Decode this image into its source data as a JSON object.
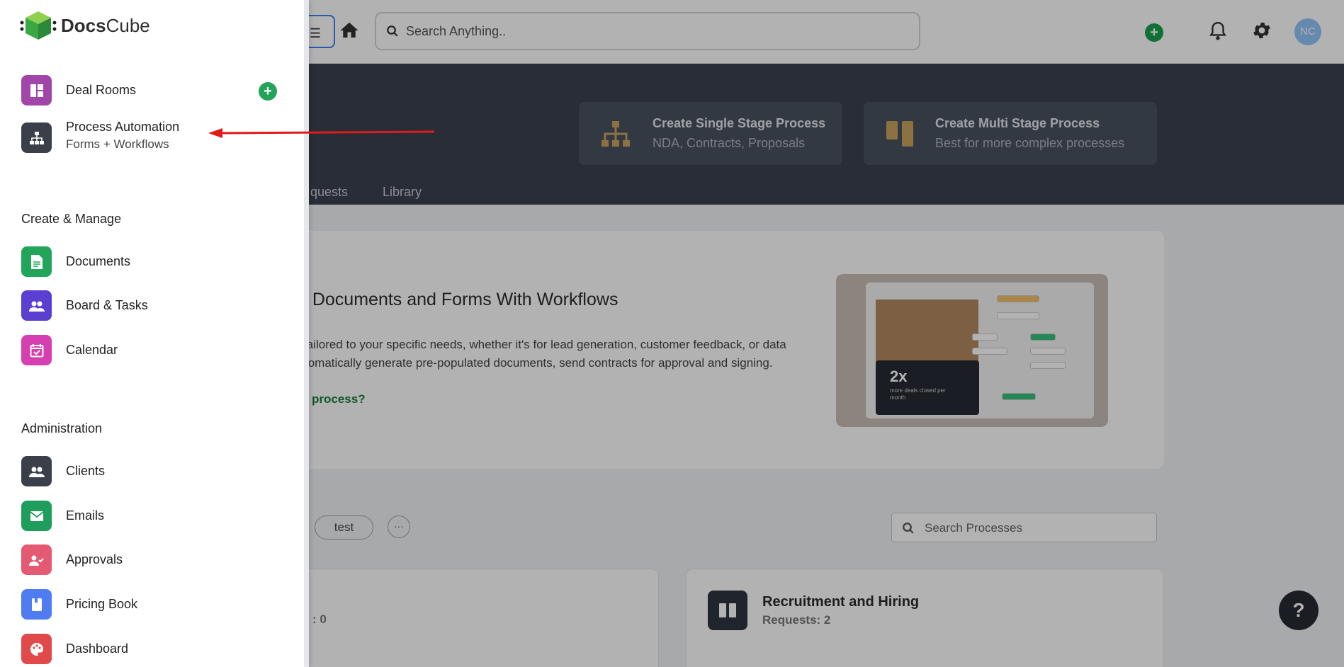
{
  "app": {
    "logo_name_bold": "Docs",
    "logo_name_light": "Cube"
  },
  "header": {
    "search_placeholder": "Search Anything..",
    "avatar_initials": "NC"
  },
  "hero": {
    "single_stage_title": "Create Single Stage Process",
    "single_stage_sub": "NDA, Contracts, Proposals",
    "multi_stage_title": "Create Multi Stage Process",
    "multi_stage_sub": "Best for more complex processes",
    "tab_requests_partial": "quests",
    "tab_library": "Library"
  },
  "promo": {
    "title_partial": "e Documents and Forms With Workflows",
    "body_line1": "tailored to your specific needs, whether it's for lead generation, customer feedback, or data",
    "body_line2": "tomatically generate pre-populated documents, send contracts for approval and signing.",
    "link_partial": "process?",
    "stat_big": "2x",
    "stat_small": "more deals closed per month"
  },
  "processes": {
    "filter_chip": "test",
    "more_label": "···",
    "search_placeholder": "Search Processes",
    "left_card_requests_partial": ": 0",
    "right_card_title": "Recruitment and Hiring",
    "right_card_requests": "Requests: 2"
  },
  "help_label": "?",
  "sidebar": {
    "deal_rooms": "Deal Rooms",
    "process_automation": "Process Automation",
    "process_automation_sub": "Forms + Workflows",
    "section_create": "Create & Manage",
    "documents": "Documents",
    "board_tasks": "Board & Tasks",
    "calendar": "Calendar",
    "section_admin": "Administration",
    "clients": "Clients",
    "emails": "Emails",
    "approvals": "Approvals",
    "pricing_book": "Pricing Book",
    "dashboard": "Dashboard"
  },
  "colors": {
    "deal_rooms": "#a146a8",
    "process_automation": "#3a3f4a",
    "documents": "#22a55a",
    "board_tasks": "#5b3fd1",
    "calendar": "#d63fb0",
    "clients": "#3a3f4a",
    "emails": "#1f9d5c",
    "approvals": "#e35a72",
    "pricing_book": "#4f7cf0",
    "dashboard": "#e04a4a",
    "arrow": "#e01b1b"
  }
}
